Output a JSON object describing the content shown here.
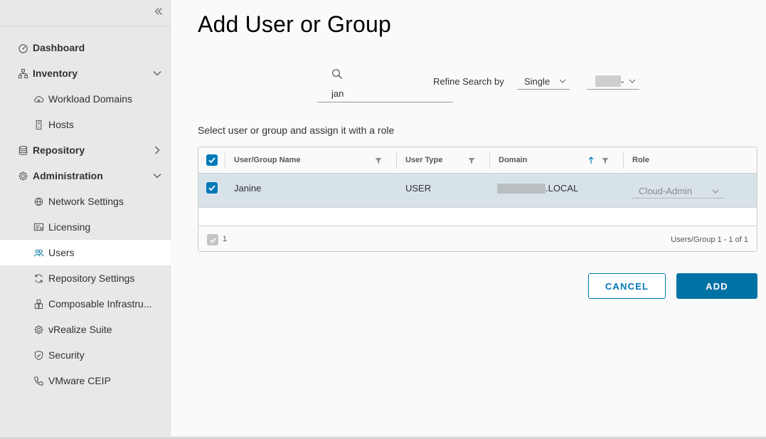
{
  "sidebar": {
    "collapse_icon": "double-chevron-left-icon",
    "items": [
      {
        "label": "Dashboard",
        "icon": "dashboard-icon",
        "level": "top"
      },
      {
        "label": "Inventory",
        "icon": "inventory-icon",
        "level": "top",
        "expanded": true
      },
      {
        "label": "Workload Domains",
        "icon": "cloud-icon",
        "level": "sub"
      },
      {
        "label": "Hosts",
        "icon": "host-icon",
        "level": "sub"
      },
      {
        "label": "Repository",
        "icon": "database-icon",
        "level": "top",
        "expanded": false
      },
      {
        "label": "Administration",
        "icon": "gear-icon",
        "level": "top",
        "expanded": true
      },
      {
        "label": "Network Settings",
        "icon": "network-icon",
        "level": "sub"
      },
      {
        "label": "Licensing",
        "icon": "license-icon",
        "level": "sub"
      },
      {
        "label": "Users",
        "icon": "users-icon",
        "level": "sub",
        "active": true
      },
      {
        "label": "Repository Settings",
        "icon": "sync-icon",
        "level": "sub"
      },
      {
        "label": "Composable Infrastru...",
        "icon": "composable-icon",
        "level": "sub"
      },
      {
        "label": "vRealize Suite",
        "icon": "gear-icon",
        "level": "sub"
      },
      {
        "label": "Security",
        "icon": "shield-icon",
        "level": "sub"
      },
      {
        "label": "VMware CEIP",
        "icon": "phone-icon",
        "level": "sub"
      }
    ]
  },
  "main": {
    "title": "Add User or Group",
    "search": {
      "value": "jan",
      "placeholder": "",
      "icon": "search-icon"
    },
    "refine": {
      "label": "Refine Search by",
      "mode": "Single",
      "domain_suffix": "-"
    },
    "instruction": "Select user or group and assign it with a role",
    "table": {
      "columns": [
        "User/Group Name",
        "User Type",
        "Domain",
        "Role"
      ],
      "rows": [
        {
          "selected": true,
          "name": "Janine",
          "type": "USER",
          "domain_suffix": ".LOCAL",
          "role": "Cloud-Admin"
        }
      ],
      "selected_count": "1",
      "pagination": "Users/Group 1 - 1 of 1"
    },
    "buttons": {
      "cancel": "CANCEL",
      "add": "ADD"
    }
  },
  "colors": {
    "accent": "#0079b8",
    "primary_button": "#0072a3",
    "row_selected": "#d8e3e9",
    "sidebar_bg": "#e8e8e8"
  }
}
